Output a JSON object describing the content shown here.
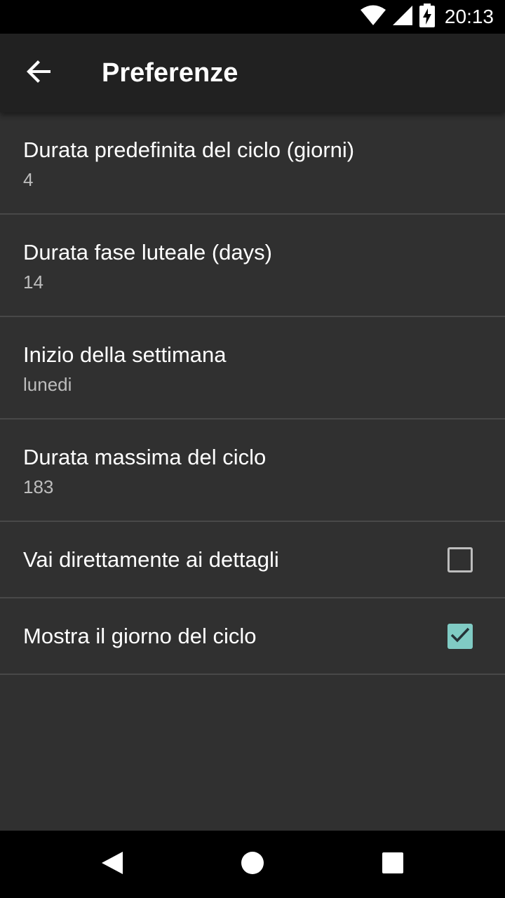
{
  "status_bar": {
    "time": "20:13",
    "icons": [
      "wifi-icon",
      "cell-signal-icon",
      "battery-charging-icon"
    ]
  },
  "app_bar": {
    "title": "Preferenze",
    "back_icon": "arrow-back-icon"
  },
  "preferences": [
    {
      "title": "Durata predefinita del ciclo (giorni)",
      "summary": "4"
    },
    {
      "title": "Durata fase luteale (days)",
      "summary": "14"
    },
    {
      "title": "Inizio della settimana",
      "summary": "lunedi"
    },
    {
      "title": "Durata massima del ciclo",
      "summary": "183"
    },
    {
      "title": "Vai direttamente ai dettagli",
      "checked": false
    },
    {
      "title": "Mostra il giorno del ciclo",
      "checked": true
    }
  ],
  "colors": {
    "background": "#303030",
    "app_bar": "#212121",
    "accent": "#80cbc4",
    "divider": "#484848",
    "summary_text": "#bdbdbd"
  },
  "nav_bar": {
    "icons": [
      "back-triangle-icon",
      "home-circle-icon",
      "recents-square-icon"
    ]
  }
}
